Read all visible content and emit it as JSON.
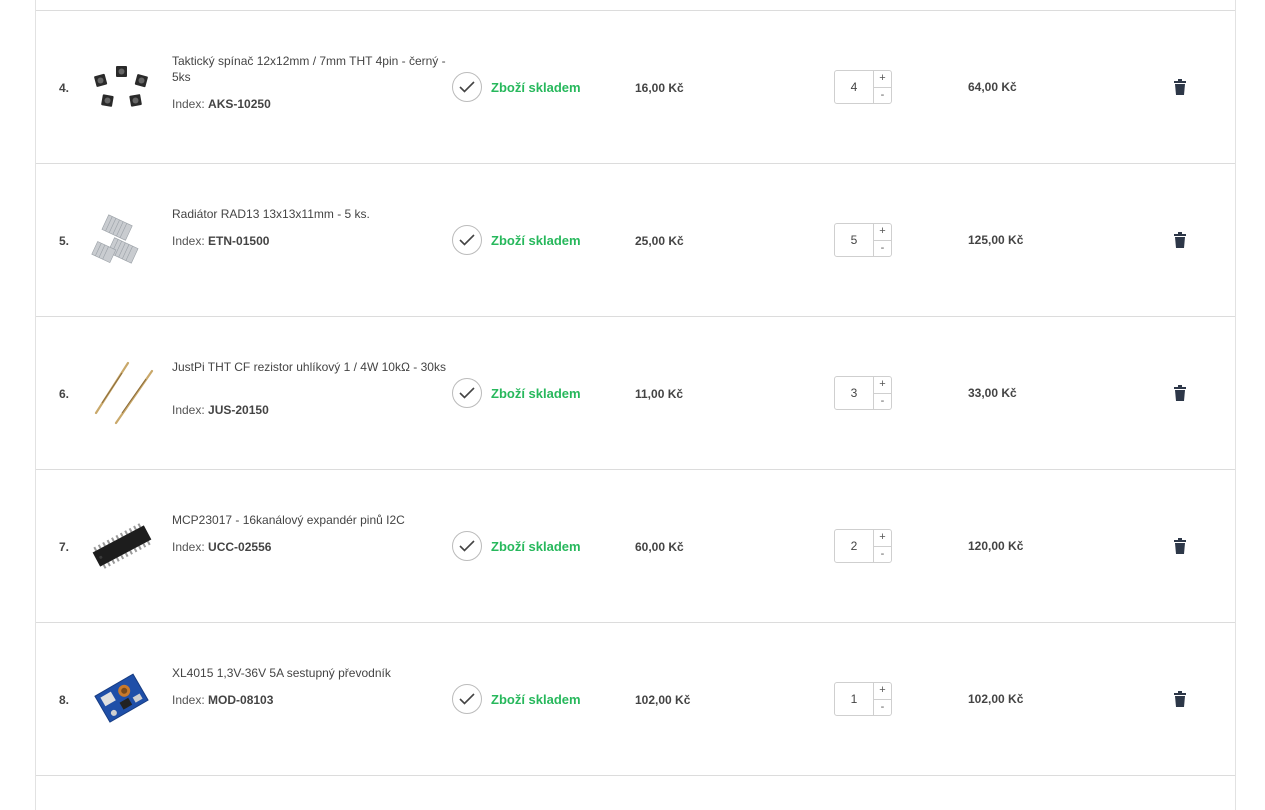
{
  "rows": [
    {
      "number": "4.",
      "name": "Taktický spínač 12x12mm / 7mm THT 4pin - černý - 5ks",
      "index_label": "Index:",
      "index": "AKS-10250",
      "stock": "Zboží skladem",
      "price": "16,00 Kč",
      "quantity": "4",
      "total": "64,00 Kč",
      "thumb": "tactile-switch"
    },
    {
      "number": "5.",
      "name": "Radiátor RAD13 13x13x11mm - 5 ks.",
      "index_label": "Index:",
      "index": "ETN-01500",
      "stock": "Zboží skladem",
      "price": "25,00 Kč",
      "quantity": "5",
      "total": "125,00 Kč",
      "thumb": "heatsink"
    },
    {
      "number": "6.",
      "name": "JustPi THT CF rezistor uhlíkový 1 / 4W 10kΩ - 30ks",
      "index_label": "Index:",
      "index": "JUS-20150",
      "stock": "Zboží skladem",
      "price": "11,00 Kč",
      "quantity": "3",
      "total": "33,00 Kč",
      "thumb": "resistor"
    },
    {
      "number": "7.",
      "name": "MCP23017 - 16kanálový expandér pinů I2C",
      "index_label": "Index:",
      "index": "UCC-02556",
      "stock": "Zboží skladem",
      "price": "60,00 Kč",
      "quantity": "2",
      "total": "120,00 Kč",
      "thumb": "dip-chip"
    },
    {
      "number": "8.",
      "name": "XL4015 1,3V-36V 5A sestupný převodník",
      "index_label": "Index:",
      "index": "MOD-08103",
      "stock": "Zboží skladem",
      "price": "102,00 Kč",
      "quantity": "1",
      "total": "102,00 Kč",
      "thumb": "converter-module"
    }
  ],
  "stepper": {
    "plus": "+",
    "minus": "-"
  },
  "colors": {
    "stock_green": "#27b85c",
    "trash": "#2d3748",
    "border": "#dcdcdc"
  },
  "icons": {
    "stock": "check-icon",
    "remove": "trash-icon"
  }
}
